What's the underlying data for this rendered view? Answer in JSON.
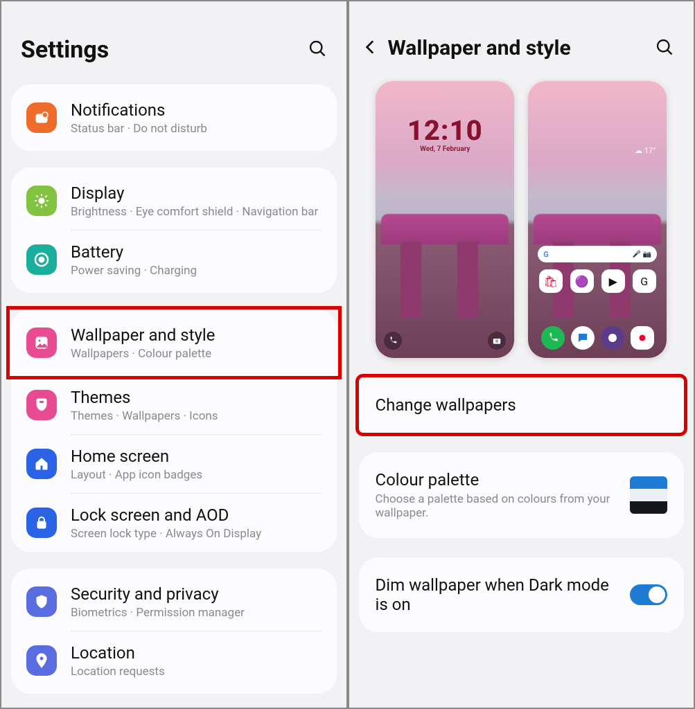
{
  "left": {
    "title": "Settings",
    "groups": [
      {
        "items": [
          {
            "key": "notifications",
            "title": "Notifications",
            "sub": "Status bar  ·  Do not disturb"
          }
        ]
      },
      {
        "items": [
          {
            "key": "display",
            "title": "Display",
            "sub": "Brightness  ·  Eye comfort shield  ·  Navigation bar"
          },
          {
            "key": "battery",
            "title": "Battery",
            "sub": "Power saving  ·  Charging"
          }
        ]
      },
      {
        "items": [
          {
            "key": "wallpaper",
            "title": "Wallpaper and style",
            "sub": "Wallpapers  ·  Colour palette",
            "highlight": true
          },
          {
            "key": "themes",
            "title": "Themes",
            "sub": "Themes  ·  Wallpapers  ·  Icons"
          },
          {
            "key": "home",
            "title": "Home screen",
            "sub": "Layout  ·  App icon badges"
          },
          {
            "key": "lock",
            "title": "Lock screen and AOD",
            "sub": "Screen lock type  ·  Always On Display"
          }
        ]
      },
      {
        "items": [
          {
            "key": "security",
            "title": "Security and privacy",
            "sub": "Biometrics  ·  Permission manager"
          },
          {
            "key": "location",
            "title": "Location",
            "sub": "Location requests"
          }
        ]
      }
    ]
  },
  "right": {
    "title": "Wallpaper and style",
    "lock_preview": {
      "time": "12:10",
      "date": "Wed, 7 February"
    },
    "home_preview": {
      "weather": "17°",
      "apps": [
        "Store",
        "Gallery",
        "Play Store",
        "Google"
      ],
      "dock": [
        "Phone",
        "Messages",
        "Internet",
        "Camera"
      ]
    },
    "change_wallpapers": "Change wallpapers",
    "colour_palette": {
      "title": "Colour palette",
      "sub": "Choose a palette based on colours from your wallpaper."
    },
    "dim": {
      "title": "Dim wallpaper when Dark mode is on",
      "on": true
    }
  }
}
